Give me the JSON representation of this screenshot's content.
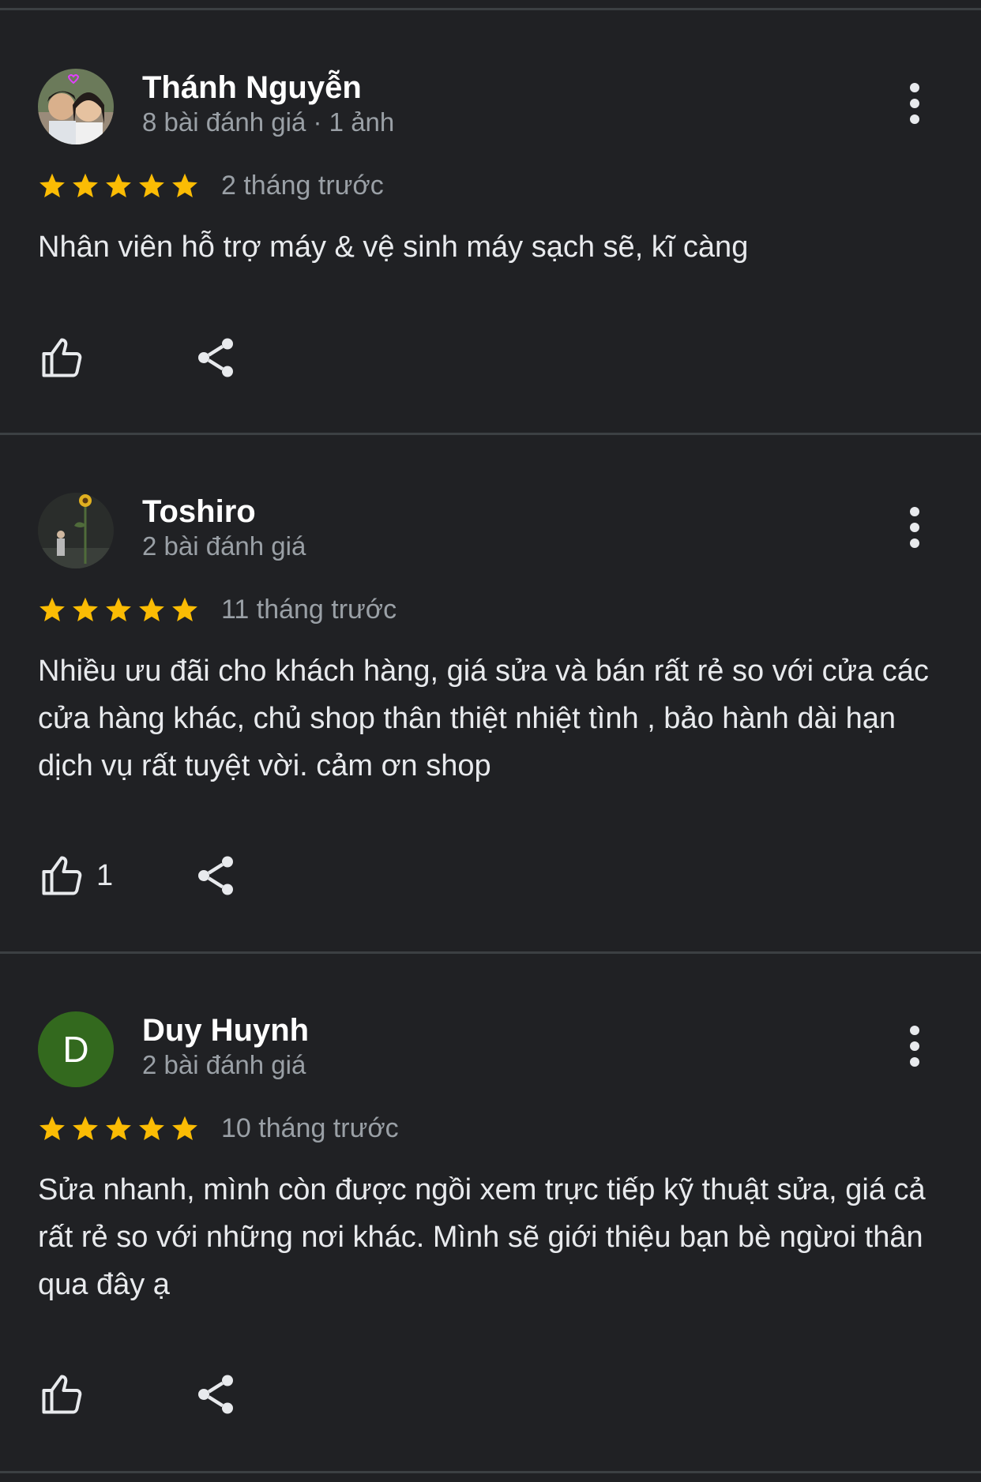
{
  "colors": {
    "background": "#202124",
    "divider": "#3c4043",
    "star": "#fbbc04",
    "name": "#ffffff",
    "secondary_text": "#9aa0a6",
    "avatar_d_bg": "#33691e"
  },
  "reviews": [
    {
      "avatar": "photo-couple",
      "name": "Thánh Nguyễn",
      "meta": "8 bài đánh giá · 1 ảnh",
      "rating": 5,
      "time": "2 tháng trước",
      "text": "Nhân viên hỗ trợ máy & vệ sinh máy sạch sẽ, kĩ càng",
      "like_count": "",
      "icons": [
        "more-vert-icon",
        "thumb-up-icon",
        "share-icon"
      ]
    },
    {
      "avatar": "photo-sunflower",
      "name": "Toshiro",
      "meta": "2 bài đánh giá",
      "rating": 5,
      "time": "11 tháng trước",
      "text": "Nhiều ưu đãi cho khách hàng, giá sửa và bán rất rẻ so với cửa các cửa hàng khác, chủ shop thân thiệt nhiệt tình , bảo hành dài hạn dịch vụ rất tuyệt vời. cảm ơn shop",
      "like_count": "1",
      "icons": [
        "more-vert-icon",
        "thumb-up-icon",
        "share-icon"
      ]
    },
    {
      "avatar": "letter",
      "avatar_letter": "D",
      "name": "Duy Huynh",
      "meta": "2 bài đánh giá",
      "rating": 5,
      "time": "10 tháng trước",
      "text": "Sửa nhanh, mình còn được ngồi xem trực tiếp kỹ thuật sửa, giá cả rất rẻ so với những nơi khác. Mình sẽ giới thiệu bạn bè ngừoi thân qua đây ạ",
      "like_count": "",
      "icons": [
        "more-vert-icon",
        "thumb-up-icon",
        "share-icon"
      ]
    }
  ]
}
